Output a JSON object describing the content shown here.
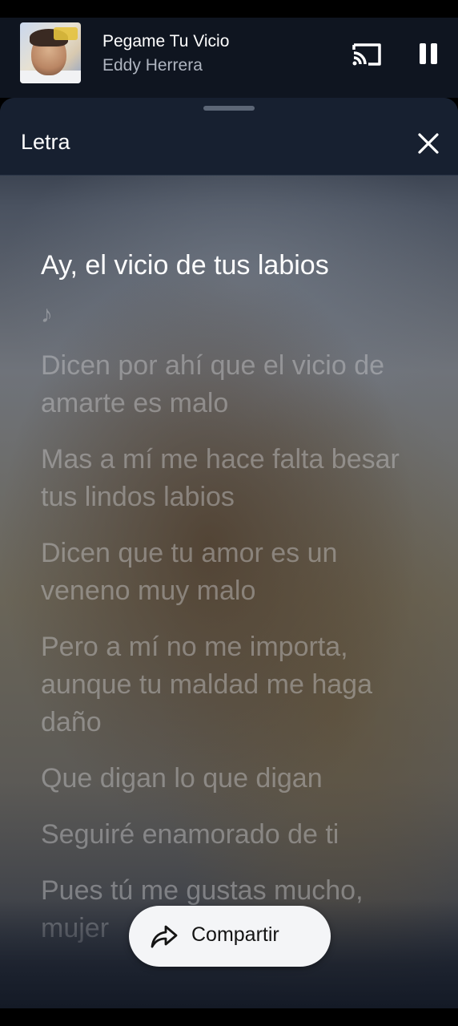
{
  "mini_player": {
    "title": "Pegame Tu Vicio",
    "artist": "Eddy Herrera",
    "album_art_icon": "album-cover",
    "cast_icon": "cast-icon",
    "pause_icon": "pause-icon"
  },
  "sheet": {
    "title": "Letra",
    "close_icon": "close-icon"
  },
  "lyrics": {
    "active_line": "Ay, el vicio de tus labios",
    "note": "♪",
    "lines": [
      "Dicen por ahí que el vicio de amarte es malo",
      "Mas a mí me hace falta besar tus lindos labios",
      "Dicen que tu amor es un veneno muy malo",
      "Pero a mí no me importa, aunque tu maldad me haga daño",
      "Que digan lo que digan",
      "Seguiré enamorado de ti",
      "Pues tú me gustas mucho, mujer"
    ]
  },
  "share": {
    "label": "Compartir",
    "icon": "share-icon"
  },
  "colors": {
    "header_bg": "#0f1520",
    "sheet_header_bg": "#172030",
    "active_lyric": "#ffffff",
    "inactive_lyric": "rgba(210,210,212,0.42)",
    "share_button_bg": "#f4f5f7"
  }
}
